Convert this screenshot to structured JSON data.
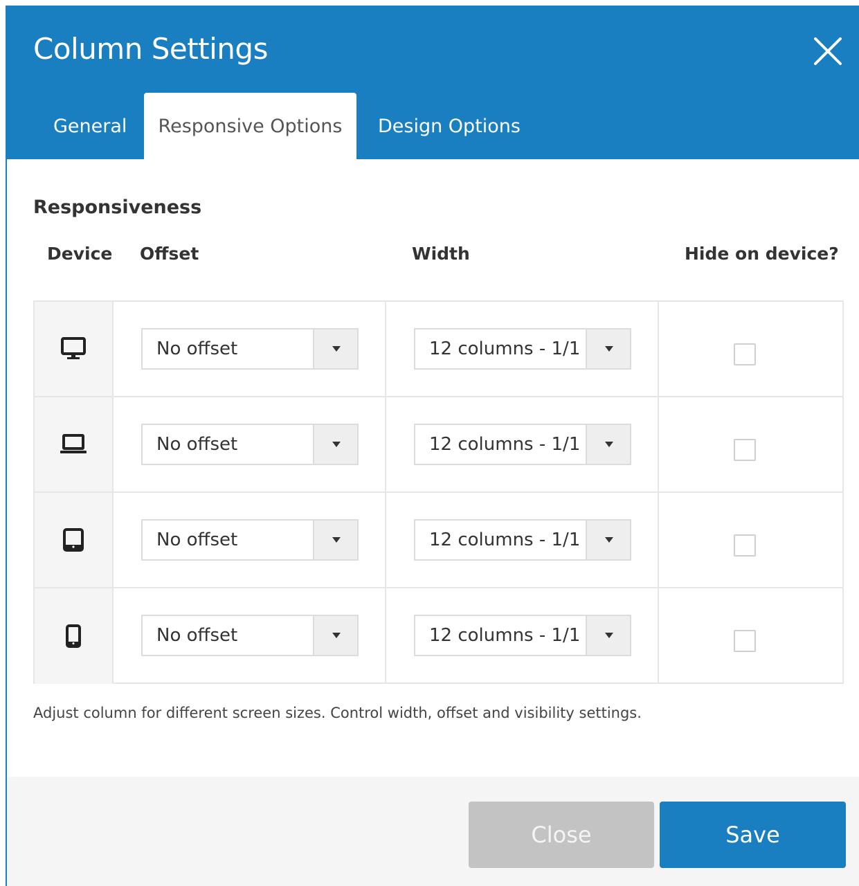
{
  "dialog": {
    "title": "Column Settings",
    "close_icon": "close-x-icon"
  },
  "tabs": [
    {
      "label": "General",
      "active": false
    },
    {
      "label": "Responsive Options",
      "active": true
    },
    {
      "label": "Design Options",
      "active": false
    }
  ],
  "section": {
    "title": "Responsiveness",
    "columns": {
      "device": "Device",
      "offset": "Offset",
      "width": "Width",
      "hide": "Hide on device?"
    },
    "rows": [
      {
        "device_icon": "desktop-icon",
        "offset": "No offset",
        "width": "12 columns - 1/1",
        "hidden": false
      },
      {
        "device_icon": "laptop-icon",
        "offset": "No offset",
        "width": "12 columns - 1/1",
        "hidden": false
      },
      {
        "device_icon": "tablet-icon",
        "offset": "No offset",
        "width": "12 columns - 1/1",
        "hidden": false
      },
      {
        "device_icon": "mobile-icon",
        "offset": "No offset",
        "width": "12 columns - 1/1",
        "hidden": false
      }
    ],
    "help_text": "Adjust column for different screen sizes. Control width, offset and visibility settings."
  },
  "footer": {
    "close_label": "Close",
    "save_label": "Save"
  },
  "colors": {
    "accent": "#1a7fc1",
    "close_button": "#c3c3c3",
    "footer_bg": "#f5f5f5"
  }
}
